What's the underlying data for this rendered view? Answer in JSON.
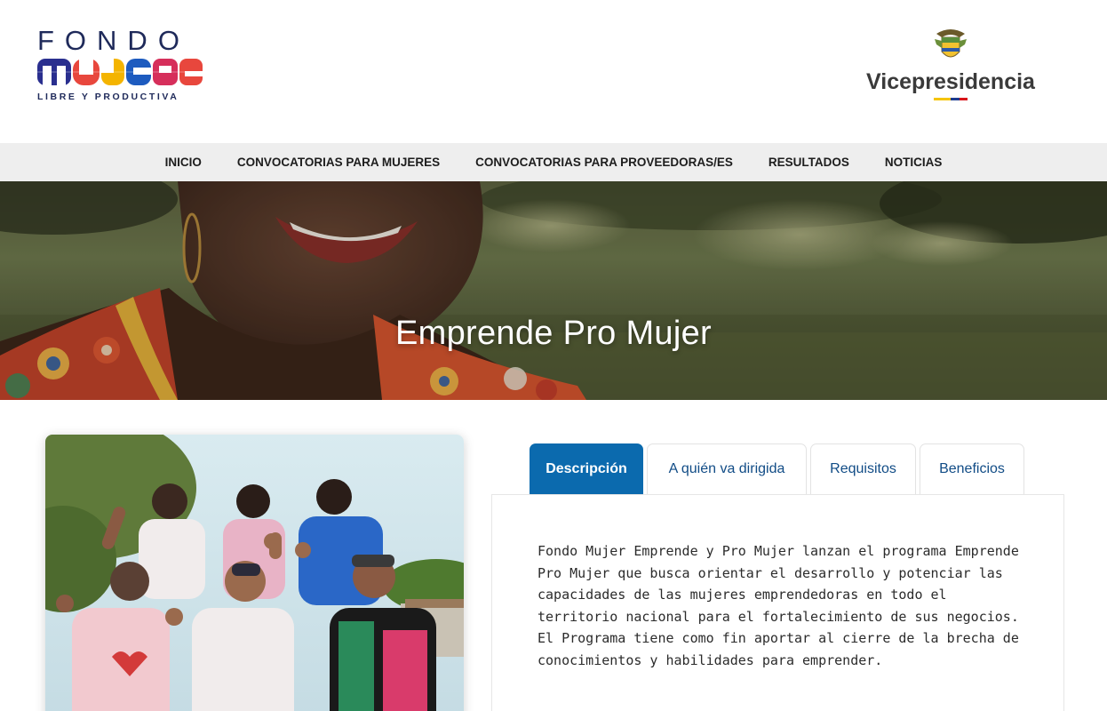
{
  "header": {
    "logo_left": {
      "line1": "FONDO",
      "line2": "MUJER",
      "line3": "LIBRE Y PRODUCTIVA"
    },
    "logo_right": {
      "name": "Vicepresidencia",
      "icon": "coat-of-arms-icon",
      "flag_colors": [
        "#f5c400",
        "#1d3c8f",
        "#d7141a"
      ]
    }
  },
  "nav": {
    "items": [
      {
        "label": "INICIO"
      },
      {
        "label": "CONVOCATORIAS PARA MUJERES"
      },
      {
        "label": "CONVOCATORIAS PARA PROVEEDORAS/ES"
      },
      {
        "label": "RESULTADOS"
      },
      {
        "label": "NOTICIAS"
      }
    ]
  },
  "hero": {
    "title": "Emprende Pro Mujer"
  },
  "tabs": {
    "items": [
      {
        "label": "Descripción",
        "active": true
      },
      {
        "label": "A quién va dirigida",
        "active": false
      },
      {
        "label": "Requisitos",
        "active": false
      },
      {
        "label": "Beneficios",
        "active": false
      }
    ],
    "description": "Fondo Mujer Emprende y Pro Mujer lanzan el programa Emprende Pro Mujer que busca orientar el desarrollo y potenciar las capacidades de las mujeres emprendedoras en todo el territorio nacional para el fortalecimiento de sus negocios. El Programa tiene como fin aportar al cierre de la brecha de conocimientos y habilidades para emprender."
  },
  "colors": {
    "accent": "#0b6aae",
    "nav_bg": "#eeeeee",
    "tab_text": "#114c86"
  }
}
